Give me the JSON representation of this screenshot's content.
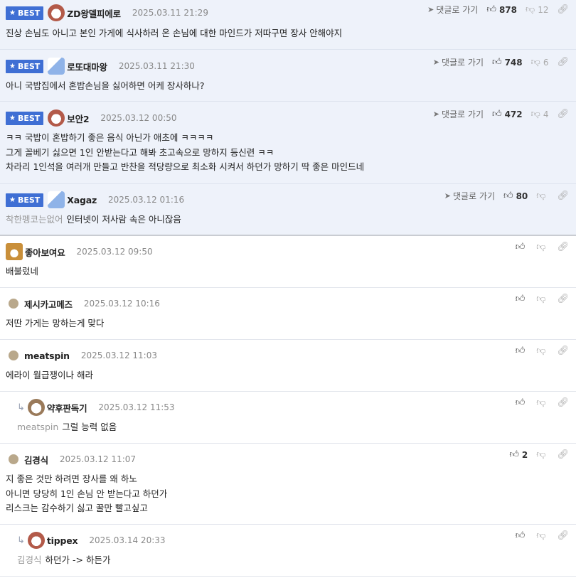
{
  "labels": {
    "best": "BEST",
    "goto": "댓글로 가기"
  },
  "comments": [
    {
      "name": "ZD왕델피에로",
      "date": "2025.03.11 21:29",
      "up": "878",
      "down": "12",
      "lines": [
        "진상 손님도 아니고 본인 가게에 식사하러 온 손님에 대한 마인드가 저따구면 장사 안해야지"
      ]
    },
    {
      "name": "로또대마왕",
      "date": "2025.03.11 21:30",
      "up": "748",
      "down": "6",
      "lines": [
        "아니 국밥집에서 혼밥손님을 싫어하면 어케 장사하나?"
      ]
    },
    {
      "name": "보안2",
      "date": "2025.03.12 00:50",
      "up": "472",
      "down": "4",
      "lines": [
        "ㅋㅋ 국밥이 혼밥하기 좋은 음식 아닌가 애초에 ㅋㅋㅋㅋ",
        "그게 꼴베기 싫으면 1인 안받는다고 해봐 초고속으로 망하지 등신련 ㅋㅋ",
        "차라리 1인석을 여러개 만들고 반찬을 적당량으로 최소화 시켜서 하던가 망하기 딱 좋은 마인드네"
      ]
    },
    {
      "name": "Xagaz",
      "date": "2025.03.12 01:16",
      "up": "80",
      "mention": "착한펭코는없어",
      "lines": [
        "인터넷이 저사람 속은 아니잖음"
      ]
    },
    {
      "name": "좋아보여요",
      "date": "2025.03.12 09:50",
      "lines": [
        "배불렀네"
      ]
    },
    {
      "name": "제시카고메즈",
      "date": "2025.03.12 10:16",
      "lines": [
        "저딴 가게는 망하는게 맞다"
      ]
    },
    {
      "name": "meatspin",
      "date": "2025.03.12 11:03",
      "lines": [
        "에라이 월급쟁이나 해라"
      ]
    },
    {
      "name": "약후판독기",
      "date": "2025.03.12 11:53",
      "mention": "meatspin",
      "lines": [
        "그럴 능력 없음"
      ]
    },
    {
      "name": "김경식",
      "date": "2025.03.12 11:07",
      "up": "2",
      "lines": [
        "지 좋은 것만 하려면 장사를 왜 하노",
        "아니면 당당히 1인 손님 안 받는다고 하던가",
        "리스크는 감수하기 싫고 꿀만 빨고싶고"
      ]
    },
    {
      "name": "tippex",
      "date": "2025.03.14 20:33",
      "mention": "김경식",
      "lines": [
        "하던가 -> 하든가"
      ]
    }
  ]
}
